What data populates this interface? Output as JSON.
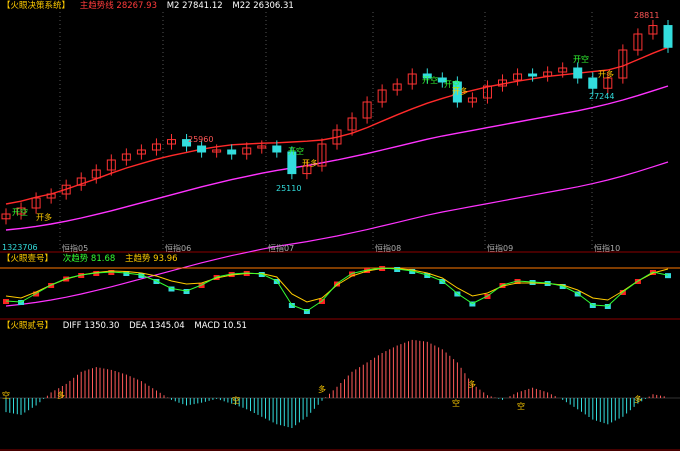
{
  "panel1": {
    "title": "【火眼决策系统】",
    "legend": [
      {
        "label": "主趋势线 28267.93",
        "color": "#ff3b3b"
      },
      {
        "label": "M2 27841.12",
        "color": "#ffffff"
      },
      {
        "label": "M22 26306.31",
        "color": "#ffffff"
      }
    ],
    "month_labels": [
      "恒指05",
      "恒指06",
      "恒指07",
      "恒指08",
      "恒指09",
      "恒指10"
    ],
    "price_labels": [
      {
        "text": "28811",
        "color": "#ff5555"
      },
      {
        "text": "25960",
        "color": "#ff5555"
      },
      {
        "text": "25110",
        "color": "#33dddd"
      },
      {
        "text": "27244",
        "color": "#33dddd"
      },
      {
        "text": "1323706",
        "color": "#33dddd"
      }
    ],
    "signals": [
      {
        "text": "开空",
        "color": "#33ff33"
      },
      {
        "text": "开多",
        "color": "#ffcc00"
      },
      {
        "text": "开空",
        "color": "#33ff33"
      },
      {
        "text": "开多",
        "color": "#ffcc00"
      },
      {
        "text": "开空",
        "color": "#33ff33"
      },
      {
        "text": "开空",
        "color": "#33ff33"
      },
      {
        "text": "开多",
        "color": "#ffcc00"
      },
      {
        "text": "开空",
        "color": "#33ff33"
      },
      {
        "text": "开多",
        "color": "#ffcc00"
      }
    ]
  },
  "panel2": {
    "title": "【火眼壹号】",
    "legend": [
      {
        "label": "次趋势 81.68",
        "color": "#33ff33"
      },
      {
        "label": "主趋势 93.96",
        "color": "#ffcc00"
      }
    ]
  },
  "panel3": {
    "title": "【火眼贰号】",
    "legend": [
      {
        "label": "DIFF 1350.30",
        "color": "#ffffff"
      },
      {
        "label": "DEA 1345.04",
        "color": "#ffffff"
      },
      {
        "label": "MACD 10.51",
        "color": "#ffffff"
      }
    ],
    "markers": [
      {
        "text": "空",
        "color": "#ffcc00"
      },
      {
        "text": "多",
        "color": "#ffcc00"
      },
      {
        "text": "空",
        "color": "#ffcc00"
      },
      {
        "text": "多",
        "color": "#ffcc00"
      },
      {
        "text": "空",
        "color": "#ffcc00"
      },
      {
        "text": "多",
        "color": "#ffcc00"
      },
      {
        "text": "空",
        "color": "#ffcc00"
      },
      {
        "text": "多",
        "color": "#ffcc00"
      }
    ]
  },
  "chart_data": {
    "type": "candlestick",
    "series": [
      {
        "name": "主趋势线",
        "values": [
          24350,
          24420,
          24520,
          24600,
          24720,
          24850,
          24980,
          25120,
          25250,
          25360,
          25470,
          25560,
          25640,
          25720,
          25780,
          25830,
          25850,
          25870,
          25880,
          25900,
          25920,
          25950,
          26020,
          26120,
          26260,
          26420,
          26580,
          26730,
          26870,
          26990,
          27100,
          27190,
          27280,
          27350,
          27420,
          27480,
          27540,
          27580,
          27620,
          27660,
          27700,
          27800,
          27960,
          28120,
          28267.93
        ]
      },
      {
        "name": "M22",
        "values": [
          23700,
          23740,
          23790,
          23850,
          23920,
          24000,
          24090,
          24180,
          24280,
          24380,
          24480,
          24580,
          24680,
          24780,
          24870,
          24960,
          25040,
          25120,
          25190,
          25250,
          25310,
          25380,
          25450,
          25530,
          25610,
          25700,
          25790,
          25880,
          25970,
          26050,
          26120,
          26190,
          26260,
          26330,
          26400,
          26470,
          26540,
          26610,
          26680,
          26760,
          26850,
          26950,
          27060,
          27180,
          27300
        ]
      }
    ],
    "closes": [
      24100,
      24250,
      24500,
      24600,
      24820,
      25000,
      25200,
      25450,
      25600,
      25700,
      25850,
      25960,
      25800,
      25650,
      25700,
      25600,
      25750,
      25800,
      25650,
      25110,
      25300,
      25850,
      26200,
      26500,
      26900,
      27200,
      27350,
      27600,
      27500,
      27400,
      26900,
      27000,
      27300,
      27450,
      27600,
      27550,
      27650,
      27750,
      27500,
      27244,
      27500,
      28200,
      28600,
      28811,
      28267.93
    ],
    "lines_osc": {
      "series": [
        {
          "name": "次趋势",
          "values": [
            30,
            28,
            45,
            62,
            75,
            82,
            86,
            88,
            86,
            82,
            70,
            55,
            50,
            62,
            78,
            84,
            86,
            84,
            70,
            22,
            10,
            30,
            65,
            85,
            92,
            96,
            94,
            90,
            82,
            70,
            45,
            25,
            40,
            62,
            70,
            68,
            66,
            60,
            45,
            22,
            20,
            48,
            70,
            88,
            81.68
          ]
        },
        {
          "name": "主趋势",
          "values": [
            40,
            36,
            48,
            62,
            74,
            82,
            87,
            90,
            89,
            86,
            80,
            70,
            64,
            66,
            76,
            82,
            85,
            85,
            78,
            44,
            28,
            36,
            62,
            80,
            90,
            95,
            95,
            92,
            86,
            76,
            56,
            40,
            46,
            60,
            66,
            66,
            65,
            62,
            52,
            36,
            32,
            50,
            70,
            86,
            93.96
          ]
        }
      ]
    },
    "macd": {
      "series": [
        {
          "name": "MACD",
          "values": [
            -150,
            -180,
            -80,
            60,
            150,
            280,
            330,
            300,
            250,
            180,
            80,
            -20,
            -80,
            -50,
            -10,
            -60,
            -120,
            -200,
            -280,
            -320,
            -200,
            -30,
            120,
            280,
            380,
            480,
            560,
            620,
            600,
            520,
            380,
            150,
            30,
            -20,
            60,
            110,
            60,
            -20,
            -120,
            -230,
            -280,
            -200,
            -60,
            40,
            10.51
          ]
        }
      ]
    }
  }
}
